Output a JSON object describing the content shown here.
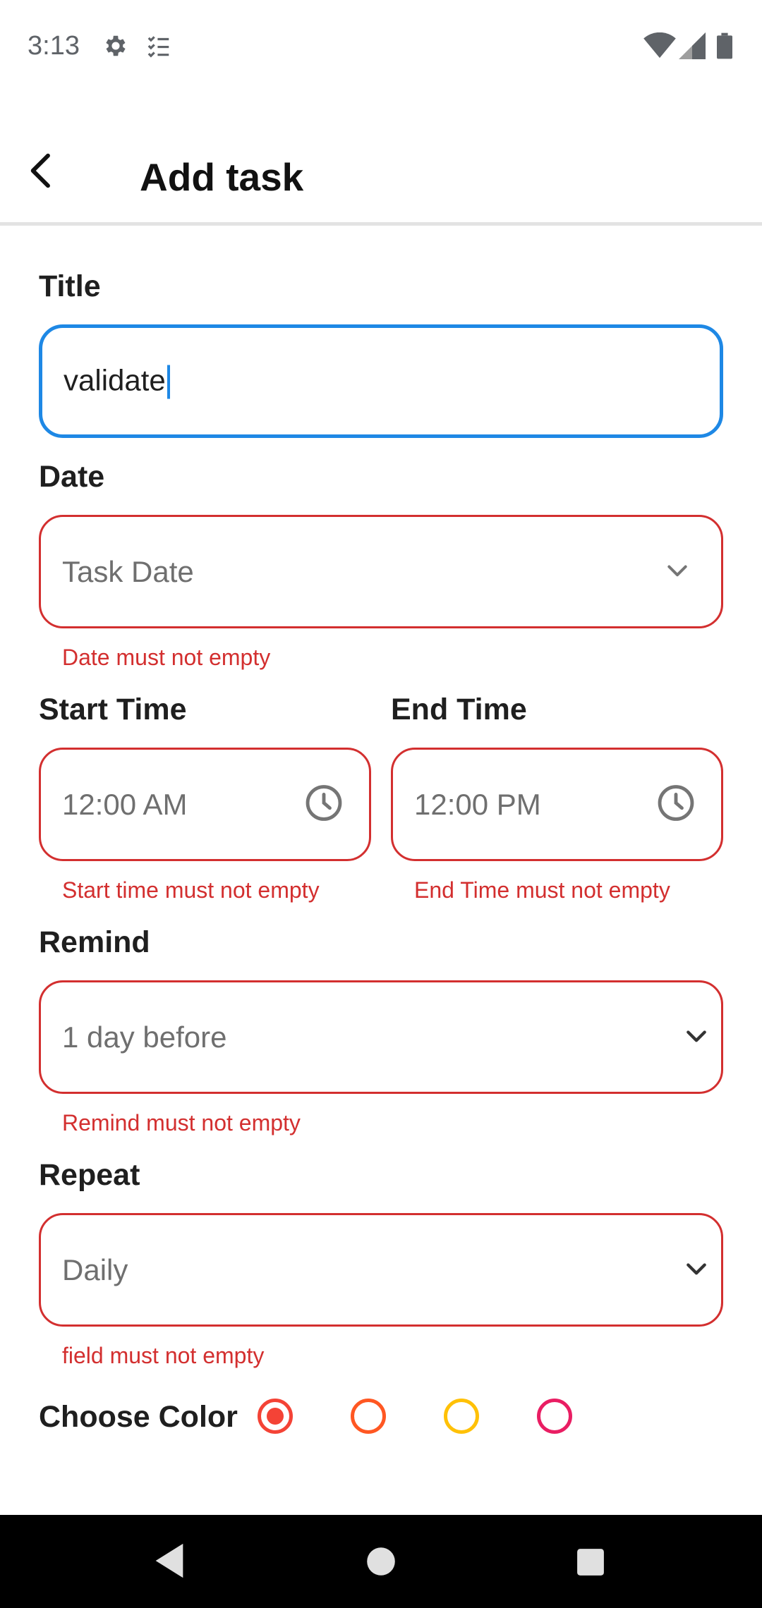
{
  "status_bar": {
    "time": "3:13",
    "icons": [
      "gear-icon",
      "checklist-icon",
      "wifi-icon",
      "signal-icon",
      "battery-icon"
    ]
  },
  "app_bar": {
    "title": "Add task",
    "back_icon": "chevron-left-icon"
  },
  "form": {
    "title": {
      "label": "Title",
      "value": "validate"
    },
    "date": {
      "label": "Date",
      "placeholder": "Task Date",
      "error": "Date must not empty"
    },
    "start_time": {
      "label": "Start Time",
      "value": "12:00 AM",
      "error": "Start time must not empty"
    },
    "end_time": {
      "label": "End Time",
      "value": "12:00 PM",
      "error": "End Time must not empty"
    },
    "remind": {
      "label": "Remind",
      "value": "1 day before",
      "error": "Remind must not empty"
    },
    "repeat": {
      "label": "Repeat",
      "value": "Daily",
      "error": "field must not empty"
    },
    "color": {
      "label": "Choose Color",
      "options": [
        {
          "color": "#f44336",
          "selected": true
        },
        {
          "color": "#ff5722",
          "selected": false
        },
        {
          "color": "#ffc107",
          "selected": false
        },
        {
          "color": "#e91e63",
          "selected": false
        }
      ]
    }
  },
  "theme": {
    "error_color": "#d32f2f",
    "focus_color": "#1e88e5"
  },
  "nav_bar": {
    "icons": [
      "back-triangle-icon",
      "home-circle-icon",
      "recents-square-icon"
    ]
  }
}
